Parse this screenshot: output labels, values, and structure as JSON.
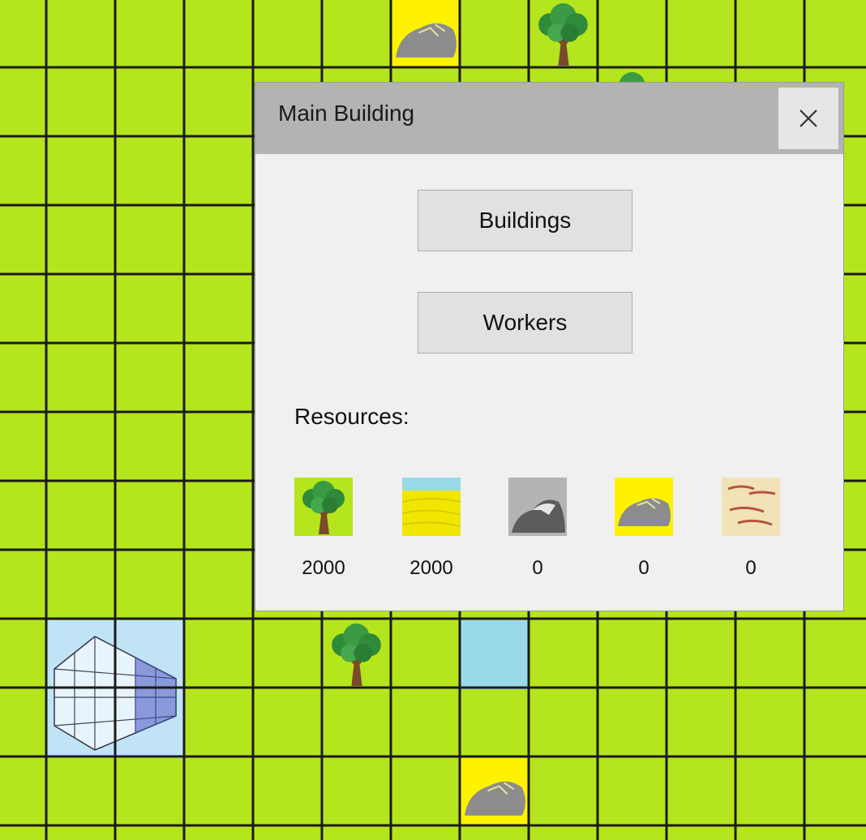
{
  "map": {
    "special_tiles": [
      {
        "col": 6,
        "row": 0,
        "type": "gold"
      },
      {
        "col": 8,
        "row": 0,
        "type": "tree"
      },
      {
        "col": 9,
        "row": 1,
        "type": "tree"
      },
      {
        "col": 1,
        "row": 9,
        "type": "main-building",
        "span": 2
      },
      {
        "col": 5,
        "row": 9,
        "type": "tree"
      },
      {
        "col": 7,
        "row": 9,
        "type": "water"
      },
      {
        "col": 7,
        "row": 11,
        "type": "gold"
      }
    ]
  },
  "dialog": {
    "title": "Main Building",
    "close_glyph": "✕",
    "buttons": {
      "buildings": "Buildings",
      "workers": "Workers"
    },
    "resources_label": "Resources:",
    "resources": [
      {
        "icon": "wood-icon",
        "value": "2000"
      },
      {
        "icon": "food-icon",
        "value": "2000"
      },
      {
        "icon": "stone-icon",
        "value": "0"
      },
      {
        "icon": "gold-icon",
        "value": "0"
      },
      {
        "icon": "clay-icon",
        "value": "0"
      }
    ]
  },
  "colors": {
    "grass": "#b5e51d",
    "gold_tile": "#fff200",
    "building_tile": "#c0e4f6",
    "dialog_bg": "#f0f0f0",
    "titlebar": "#b3b3b3"
  }
}
